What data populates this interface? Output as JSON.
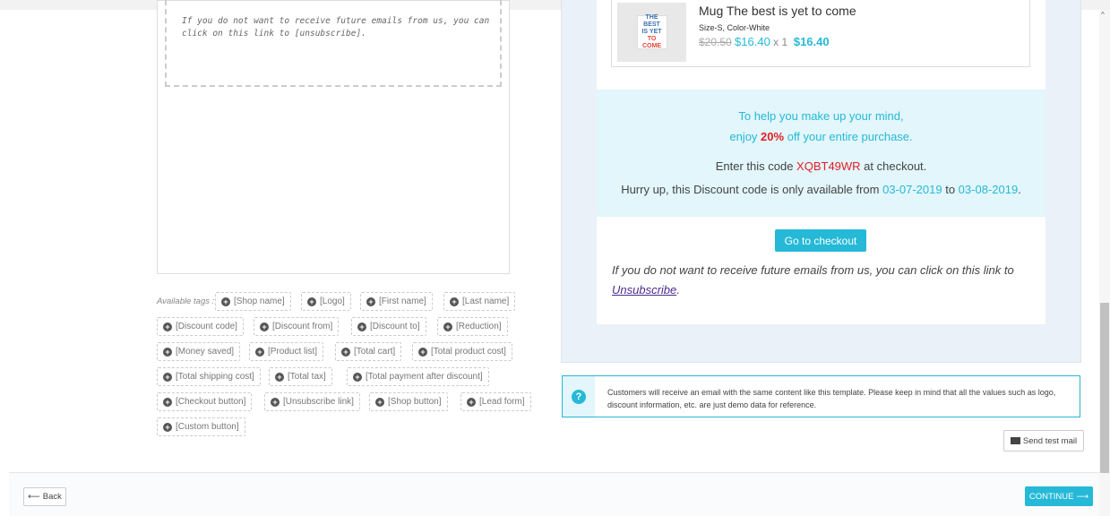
{
  "editor": {
    "text": "If you do not want to receive future emails from us, you can click on this link to [unsubscribe]."
  },
  "tags": {
    "label": "Available tags :",
    "items": [
      "[Shop name]",
      "[Logo]",
      "[First name]",
      "[Last name]",
      "[Discount code]",
      "[Discount from]",
      "[Discount to]",
      "[Reduction]",
      "[Money saved]",
      "[Product list]",
      "[Total cart]",
      "[Total product cost]",
      "[Total shipping cost]",
      "[Total tax]",
      "[Total payment after discount]",
      "[Checkout button]",
      "[Unsubscribe link]",
      "[Shop button]",
      "[Lead form]",
      "[Custom button]"
    ]
  },
  "preview": {
    "product": {
      "name": "Mug The best is yet to come",
      "attributes": "Size-S, Color-White",
      "old_price": "$20.50",
      "price": "$16.40",
      "quantity": "x 1",
      "total": "$16.40",
      "image_lines": [
        "THE",
        "BEST",
        "IS YET",
        "TO",
        "COME"
      ]
    },
    "promo": {
      "line1": "To help you make up your mind,",
      "line2_pre": "enjoy ",
      "line2_pct": "20%",
      "line2_post": " off your entire purchase.",
      "line3_pre": "Enter this code ",
      "line3_code": "XQBT49WR",
      "line3_post": " at checkout.",
      "line4_pre": "Hurry up, this Discount code is only available from ",
      "date_from": "03-07-2019",
      "line4_mid": " to ",
      "date_to": "03-08-2019",
      "line4_post": "."
    },
    "checkout_button": "Go to checkout",
    "unsubscribe_text": "If you do not want to receive future emails from us, you can click on this link to ",
    "unsubscribe_link": "Unsubscribe",
    "unsubscribe_end": "."
  },
  "info": {
    "icon": "question-circle-icon",
    "text": "Customers will receive an email with the same content like this template. Please keep in mind that all the values such as logo, discount information, etc. are just demo data for reference."
  },
  "buttons": {
    "send_test_mail": "Send test mail",
    "back": "Back",
    "continue": "CONTINUE"
  },
  "colors": {
    "accent": "#25b9d7",
    "highlight": "#e31e24",
    "promo_bg": "#e2f6fb"
  }
}
